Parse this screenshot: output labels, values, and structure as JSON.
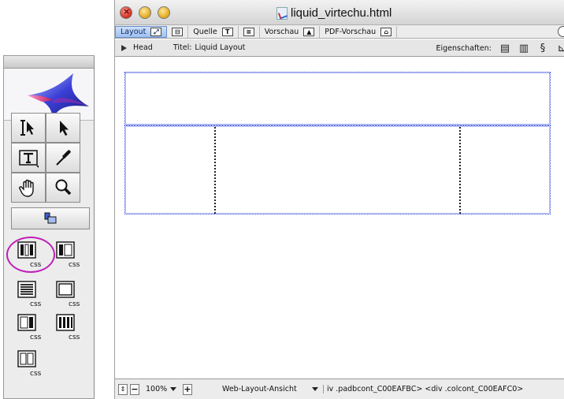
{
  "window": {
    "title": "liquid_virtechu.html"
  },
  "view_tabs": [
    {
      "label": "Layout",
      "active": true
    },
    {
      "label": "",
      "active": false
    },
    {
      "label": "Quelle",
      "active": false
    },
    {
      "label": "",
      "active": false
    },
    {
      "label": "Vorschau",
      "active": false
    },
    {
      "label": "PDF-Vorschau",
      "active": false
    }
  ],
  "infobar": {
    "head_label": "Head",
    "title_label": "Titel:",
    "title_value": "Liquid Layout",
    "properties_label": "Eigenschaften:"
  },
  "statusbar": {
    "zoom": "100%",
    "view_mode": "Web-Layout-Ansicht",
    "tag_path": "iv .padbcont_C00EAFBC> <div .colcont_C00EAFC0>"
  },
  "palette": {
    "tools": [
      "text-select-tool",
      "select-tool",
      "text-tool",
      "eyedropper-tool",
      "hand-tool",
      "zoom-tool"
    ],
    "css_buttons": [
      "css-layout-3col",
      "css-layout-2col-left",
      "css-layout-text",
      "css-layout-box",
      "css-layout-2col-right",
      "css-layout-3col-narrow",
      "css-layout-2col"
    ],
    "highlight_color": "#c01fb8"
  },
  "colors": {
    "layout_outline": "#1d36d8",
    "active_tab": "#9dc0f2"
  }
}
